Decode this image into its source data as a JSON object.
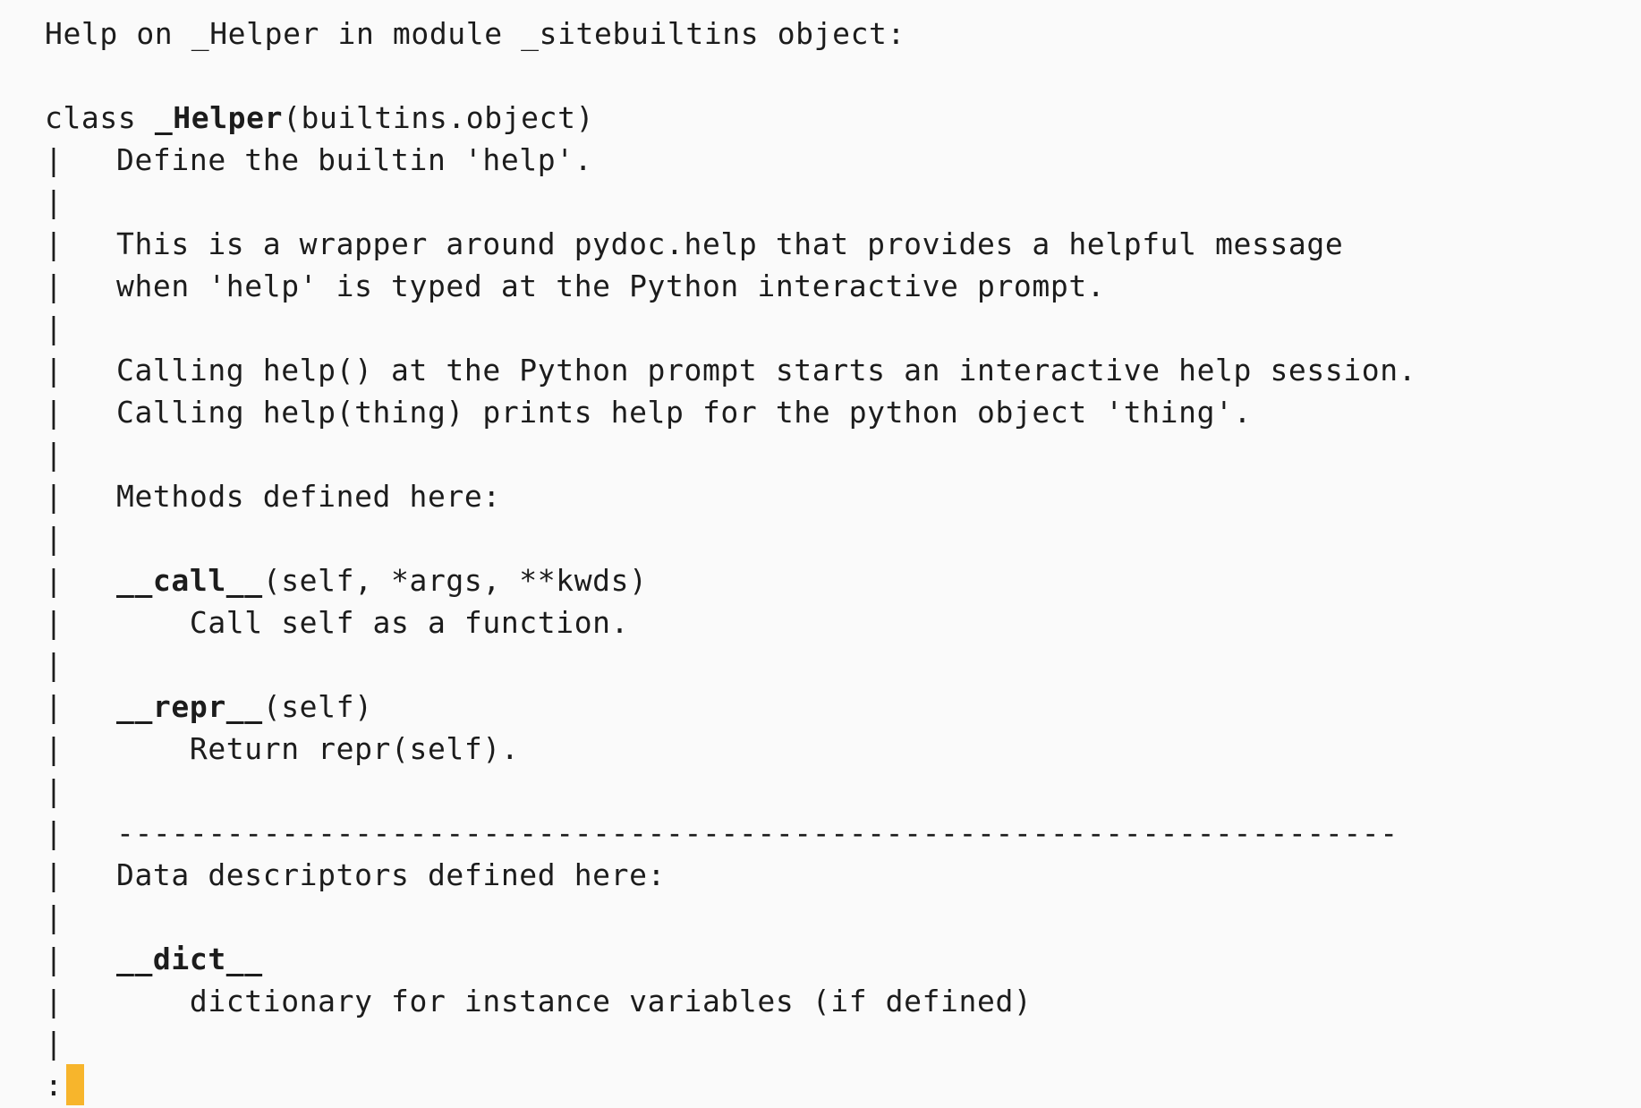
{
  "header": "Help on _Helper in module _sitebuiltins object:",
  "class_line": {
    "prefix": "class ",
    "name": "_Helper",
    "suffix": "(builtins.object)"
  },
  "bar_char": "|",
  "doc": {
    "summary": "Define the builtin 'help'.",
    "para1_line1": "This is a wrapper around pydoc.help that provides a helpful message",
    "para1_line2": "when 'help' is typed at the Python interactive prompt.",
    "para2_line1": "Calling help() at the Python prompt starts an interactive help session.",
    "para2_line2": "Calling help(thing) prints help for the python object 'thing'."
  },
  "methods": {
    "heading": "Methods defined here:",
    "items": [
      {
        "name": "__call__",
        "signature": "(self, *args, **kwds)",
        "description": "Call self as a function."
      },
      {
        "name": "__repr__",
        "signature": "(self)",
        "description": "Return repr(self)."
      }
    ]
  },
  "separator": "----------------------------------------------------------------------",
  "data_descriptors": {
    "heading": "Data descriptors defined here:",
    "items": [
      {
        "name": "__dict__",
        "description": "dictionary for instance variables (if defined)"
      }
    ]
  },
  "pager_prompt": ":",
  "colors": {
    "background": "#fafafa",
    "text": "#1c1c1c",
    "cursor": "#f7b52c"
  }
}
